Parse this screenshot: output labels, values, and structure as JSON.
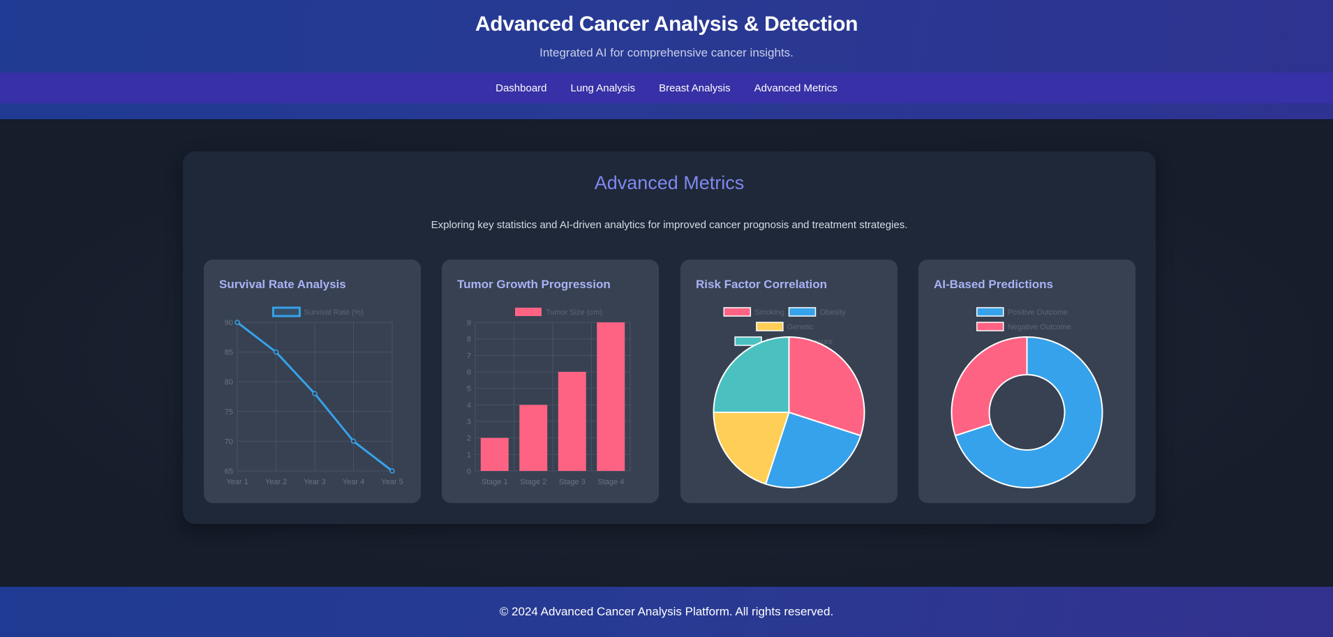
{
  "header": {
    "title": "Advanced Cancer Analysis & Detection",
    "subtitle": "Integrated AI for comprehensive cancer insights."
  },
  "nav": {
    "items": [
      {
        "label": "Dashboard"
      },
      {
        "label": "Lung Analysis"
      },
      {
        "label": "Breast Analysis"
      },
      {
        "label": "Advanced Metrics"
      }
    ]
  },
  "panel": {
    "title": "Advanced Metrics",
    "description": "Exploring key statistics and AI-driven analytics for improved cancer prognosis and treatment strategies."
  },
  "cards": [
    {
      "title": "Survival Rate Analysis"
    },
    {
      "title": "Tumor Growth Progression"
    },
    {
      "title": "Risk Factor Correlation"
    },
    {
      "title": "AI-Based Predictions"
    }
  ],
  "chart_data": [
    {
      "type": "line",
      "categories": [
        "Year 1",
        "Year 2",
        "Year 3",
        "Year 4",
        "Year 5"
      ],
      "series": [
        {
          "name": "Survival Rate (%)",
          "values": [
            90,
            85,
            78,
            70,
            65
          ],
          "color": "#36a2eb"
        }
      ],
      "ylim": [
        65,
        90
      ],
      "yticks": [
        65,
        70,
        75,
        80,
        85,
        90
      ],
      "grid": true,
      "legend": "top"
    },
    {
      "type": "bar",
      "categories": [
        "Stage 1",
        "Stage 2",
        "Stage 3",
        "Stage 4"
      ],
      "series": [
        {
          "name": "Tumor Size (cm)",
          "values": [
            2,
            4,
            6,
            9
          ],
          "color": "#ff6384"
        }
      ],
      "ylim": [
        0,
        9
      ],
      "yticks": [
        0,
        1,
        2,
        3,
        4,
        5,
        6,
        7,
        8,
        9
      ],
      "grid": true,
      "legend": "top"
    },
    {
      "type": "pie",
      "labels": [
        "Smoking",
        "Obesity",
        "Genetic",
        "Radiation Exposure"
      ],
      "values": [
        30,
        25,
        20,
        25
      ],
      "colors": [
        "#ff6384",
        "#36a2eb",
        "#ffce56",
        "#4bc0c0"
      ],
      "legend": "top"
    },
    {
      "type": "pie",
      "variant": "doughnut",
      "labels": [
        "Positive Outcome",
        "Negative Outcome"
      ],
      "values": [
        70,
        30
      ],
      "colors": [
        "#36a2eb",
        "#ff6384"
      ],
      "legend": "top"
    }
  ],
  "footer": {
    "text": "© 2024 Advanced Cancer Analysis Platform. All rights reserved."
  }
}
